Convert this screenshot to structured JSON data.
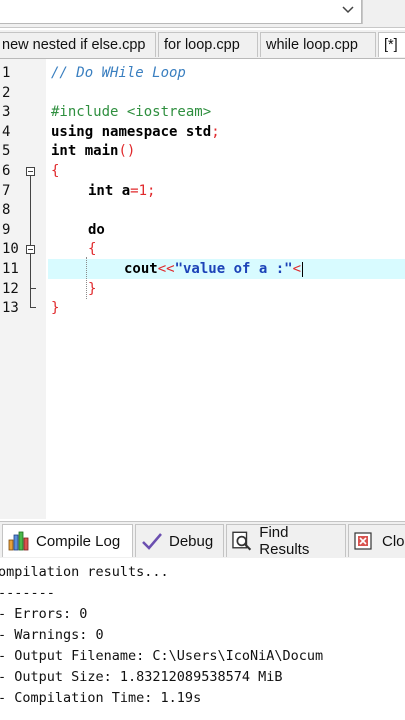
{
  "tabs": [
    {
      "label": "new nested if else.cpp",
      "active": false
    },
    {
      "label": "for loop.cpp",
      "active": false
    },
    {
      "label": "while loop.cpp",
      "active": false
    },
    {
      "label": "[*]",
      "active": true
    }
  ],
  "editor": {
    "line_numbers": [
      "1",
      "2",
      "3",
      "4",
      "5",
      "6",
      "7",
      "8",
      "9",
      "10",
      "11",
      "12",
      "13"
    ],
    "highlight_color": "#d8fbff",
    "code": {
      "l1": "// Do WHile Loop",
      "l3_pp": "#include <iostream>",
      "l4_kw1": "using",
      "l4_kw2": "namespace",
      "l4_id": "std",
      "l4_punc": ";",
      "l5_kw": "int",
      "l5_id": "main",
      "l5_punc": "()",
      "l6": "{",
      "l7_kw": "int",
      "l7_id": "a",
      "l7_op": "=",
      "l7_num": "1",
      "l7_punc": ";",
      "l9": "do",
      "l10": "{",
      "l11_id": "cout",
      "l11_op": "<<",
      "l11_str": "\"value of a :\"",
      "l11_tail": "<",
      "l12": "}",
      "l13": "}"
    }
  },
  "panel_tabs": [
    {
      "label": "Compile Log",
      "icon": "bar-chart-icon",
      "active": true
    },
    {
      "label": "Debug",
      "icon": "checkmark-icon",
      "active": false
    },
    {
      "label": "Find Results",
      "icon": "find-icon",
      "active": false
    },
    {
      "label": "Clo",
      "icon": "close-results-icon",
      "active": false
    }
  ],
  "compile_log": [
    "ompilation results...",
    "-------",
    "- Errors: 0",
    "- Warnings: 0",
    "- Output Filename: C:\\Users\\IcoNiA\\Docum",
    "- Output Size: 1.83212089538574 MiB",
    "- Compilation Time: 1.19s"
  ]
}
